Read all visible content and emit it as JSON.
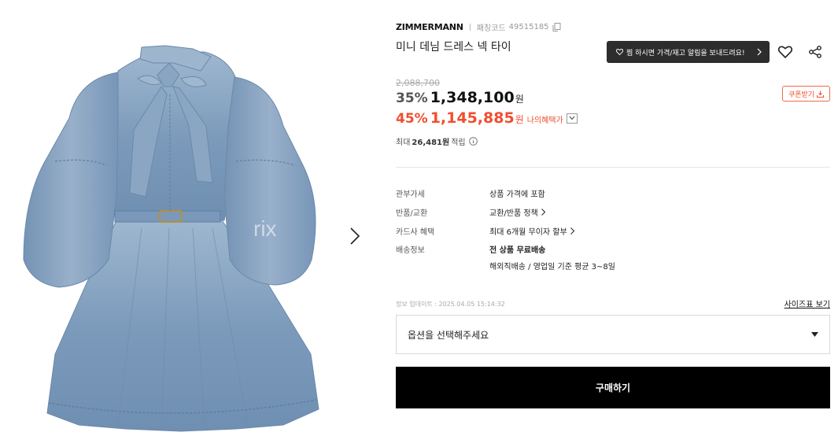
{
  "product": {
    "brand": "ZIMMERMANN",
    "code_label": "패칭코드",
    "code_value": "49515185",
    "name": "미니 데님 드레스 넥 타이",
    "watermark": "rix"
  },
  "actions": {
    "alert_text": "찜 하시면 가격/재고 알림을 보내드려요!",
    "wish_icon": "heart-outline-icon",
    "share_icon": "share-icon"
  },
  "pricing": {
    "original_price": "2,088,700",
    "discount1": "35%",
    "price1": "1,348,100",
    "won": "원",
    "discount2": "45%",
    "price2": "1,145,885",
    "my_benefit": "나의혜택가",
    "coupon_label": "쿠폰받기",
    "points_prefix": "최대",
    "points_value": "26,481원",
    "points_suffix": "적립"
  },
  "specs": [
    {
      "label": "관부가세",
      "value": "상품 가격에 포함"
    },
    {
      "label": "반품/교환",
      "value": "교환/반품 정책"
    },
    {
      "label": "카드사 혜택",
      "value": "최대 6개월 무이자 할부"
    },
    {
      "label": "배송정보",
      "value": "전 상품 무료배송",
      "value2": "해외직배송 / 영업일 기준 평균 3~8일"
    }
  ],
  "update_info": "정보 업데이트 : 2025.04.05 15:14:32",
  "size_chart_label": "사이즈표 보기",
  "option_placeholder": "옵션을 선택해주세요",
  "buy_label": "구매하기",
  "colors": {
    "accent": "#f04e2f",
    "buy_button": "#000000",
    "alert_pill": "#2d2d2d",
    "denim": "#7f9dbc"
  }
}
